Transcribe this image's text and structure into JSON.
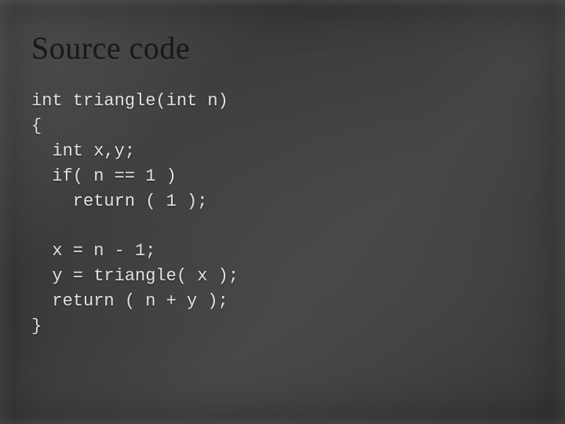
{
  "slide": {
    "title": "Source code",
    "code": "int triangle(int n)\n{\n  int x,y;\n  if( n == 1 )\n    return ( 1 );\n\n  x = n - 1;\n  y = triangle( x );\n  return ( n + y );\n}"
  }
}
